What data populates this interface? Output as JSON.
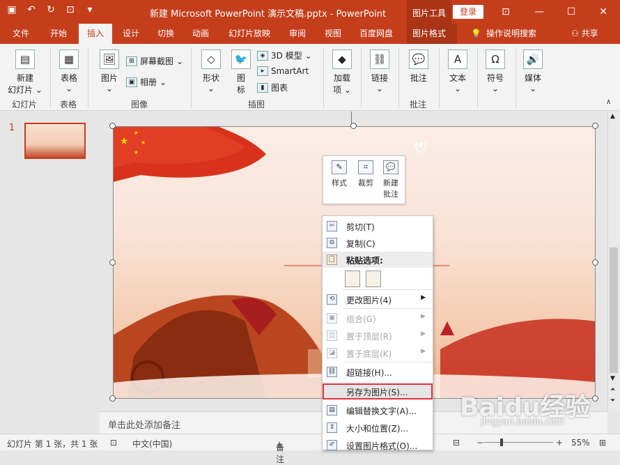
{
  "window": {
    "title": "新建 Microsoft PowerPoint 演示文稿.pptx  -  PowerPoint",
    "context_tool": "图片工具",
    "login": "登录",
    "accent": "#c43e1c"
  },
  "quick_access": [
    "save-icon",
    "undo-icon",
    "redo-icon",
    "present-icon",
    "customize-icon"
  ],
  "tabs": [
    {
      "label": "文件"
    },
    {
      "label": "开始"
    },
    {
      "label": "插入",
      "active": true
    },
    {
      "label": "设计"
    },
    {
      "label": "切换"
    },
    {
      "label": "动画"
    },
    {
      "label": "幻灯片放映"
    },
    {
      "label": "审阅"
    },
    {
      "label": "视图"
    },
    {
      "label": "百度网盘"
    },
    {
      "label": "图片格式",
      "context": true
    },
    {
      "label": "操作说明搜索"
    },
    {
      "label": "共享"
    }
  ],
  "ribbon": {
    "new_slide": "新建\n幻灯片",
    "new_slide_1": "新建",
    "new_slide_2": "幻灯片 ⌄",
    "table": "表格",
    "picture": "图片",
    "screenshot": "屏幕截图",
    "album": "相册",
    "shape": "形状",
    "icon": "图\n标",
    "model3d": "3D 模型",
    "smartart": "SmartArt",
    "chart": "图表",
    "addin": "加载\n项",
    "link": "链接",
    "comment": "批注",
    "text": "文本",
    "symbol": "符号",
    "media": "媒体",
    "groups": {
      "slides": "幻灯片",
      "tables": "表格",
      "images": "图像",
      "illustrations": "插图",
      "comments": "批注"
    }
  },
  "slide_pane": {
    "number": "1"
  },
  "mini_toolbar": {
    "style": "样式",
    "crop": "裁剪",
    "new_comment_1": "新建",
    "new_comment_2": "批注"
  },
  "context_menu": {
    "cut": "剪切(T)",
    "copy": "复制(C)",
    "paste_options": "粘贴选项:",
    "change_picture": "更改图片(4)",
    "group": "组合(G)",
    "bring_front": "置于顶层(R)",
    "send_back": "置于底层(K)",
    "hyperlink": "超链接(H)...",
    "save_as_picture": "另存为图片(S)...",
    "edit_alt_text": "编辑替换文字(A)...",
    "size_position": "大小和位置(Z)...",
    "format_picture": "设置图片格式(O)..."
  },
  "notes": {
    "placeholder": "单击此处添加备注"
  },
  "status": {
    "slide_info": "幻灯片 第 1 张，共 1 张",
    "language": "中文(中国)",
    "notes": "备注",
    "zoom": "55%"
  },
  "watermark": {
    "brand": "Baidu经验",
    "url": "jingyan.baidu.com"
  }
}
